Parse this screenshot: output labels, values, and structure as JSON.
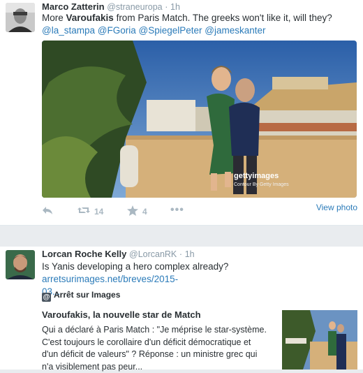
{
  "tweet1": {
    "name": "Marco Zatterin",
    "handle": "@straneuropa",
    "dot": "·",
    "time": "1h",
    "text_pre": "More ",
    "text_bold": "Varoufakis",
    "text_post": " from Paris Match. The greeks won't like it, will they?",
    "mentions": [
      "@la_stampa",
      "@FGoria",
      "@SpiegelPeter",
      "@jameskanter"
    ],
    "photo_watermark": "gettyimages",
    "photo_credit": "Contour By Getty Images",
    "retweets": "14",
    "favorites": "4",
    "view_photo": "View photo"
  },
  "tweet2": {
    "name": "Lorcan Roche Kelly",
    "handle": "@LorcanRK",
    "dot": "·",
    "time": "1h",
    "text_pre": "Is Yanis developing a hero complex already? ",
    "link_line1": "arretsurimages.net/breves/2015-",
    "link_line2": "03...",
    "card_site": "Arrêt sur Images",
    "card_title": "Varoufakis, la nouvelle star de Match",
    "card_desc_lines": [
      "Qui a déclaré à Paris Match : \"Je méprise le star-système.",
      "C'est toujours le corollaire d'un déficit démocratique et",
      "d'un déficit de valeurs\" ? Réponse : un ministre grec qui",
      "n'a visiblement pas peur..."
    ]
  },
  "colors": {
    "link": "#2b7bb9",
    "muted": "#8899a6",
    "icon": "#aab8c2"
  }
}
